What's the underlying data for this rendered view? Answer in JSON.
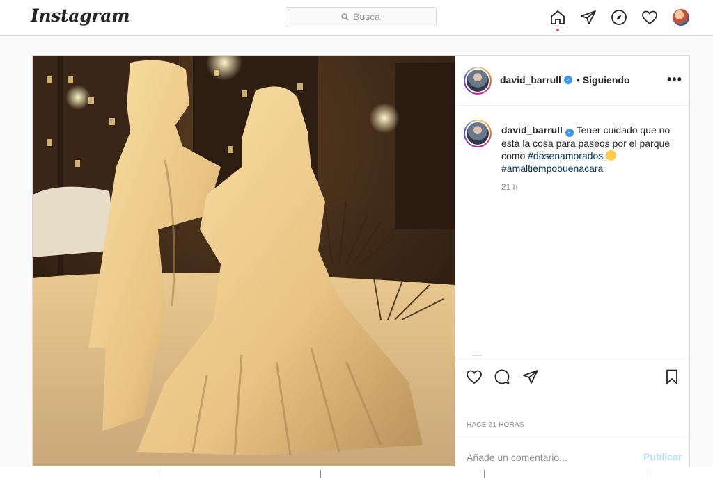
{
  "nav": {
    "logo": "Instagram",
    "search_placeholder": "Busca",
    "icons": [
      "home-icon",
      "direct-icon",
      "explore-icon",
      "activity-icon",
      "profile-avatar"
    ],
    "notification_color": "#ed4956"
  },
  "post": {
    "author": "david_barrull",
    "following_label": "Siguiendo",
    "more_label": "•••",
    "caption": {
      "username": "david_barrull",
      "text_before": "Tener cuidado que no está la cosa para paseos por el parque como",
      "hashtag1": "#dosenamorados",
      "hashtag2": "#amaltiempobuenacara",
      "time": "21 h"
    },
    "timestamp": "HACE 21 HORAS",
    "comment_placeholder": "Añade un comentario...",
    "publish_label": "Publicar"
  },
  "colors": {
    "accent_link": "#00376b",
    "verified": "#3897f0",
    "publish_disabled": "#b2dffc",
    "border": "#dbdbdb"
  }
}
